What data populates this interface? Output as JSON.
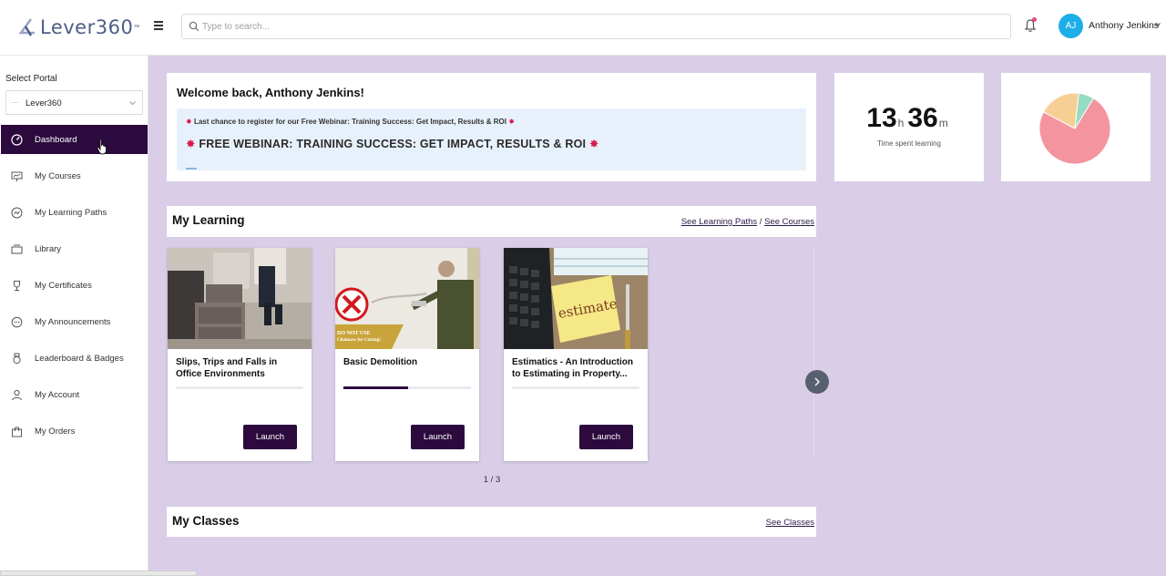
{
  "header": {
    "logo_text": "Lever360",
    "logo_tm": "™",
    "search_placeholder": "Type to search...",
    "user_initials": "AJ",
    "user_name": "Anthony Jenkins"
  },
  "sidebar": {
    "select_label": "Select Portal",
    "portal_value": "Lever360",
    "items": [
      {
        "label": "Dashboard",
        "icon": "dashboard-gauge-icon",
        "active": true
      },
      {
        "label": "My Courses",
        "icon": "presentation-icon"
      },
      {
        "label": "My Learning Paths",
        "icon": "path-icon"
      },
      {
        "label": "Library",
        "icon": "library-icon"
      },
      {
        "label": "My Certificates",
        "icon": "trophy-icon"
      },
      {
        "label": "My Announcements",
        "icon": "chat-icon"
      },
      {
        "label": "Leaderboard & Badges",
        "icon": "badge-icon"
      },
      {
        "label": "My Account",
        "icon": "user-icon"
      },
      {
        "label": "My Orders",
        "icon": "shopping-bag-icon"
      }
    ]
  },
  "welcome": {
    "title": "Welcome back, Anthony Jenkins!",
    "banner_small": "Last chance to register for our Free Webinar: Training Success: Get Impact, Results & ROI",
    "banner_big": "FREE WEBINAR: TRAINING SUCCESS: GET IMPACT, RESULTS & ROI"
  },
  "time_spent": {
    "hours": "13",
    "hours_unit": "h",
    "minutes": "36",
    "minutes_unit": "m",
    "label": "Time spent learning"
  },
  "pie": {
    "colors": [
      "#f4949f",
      "#f7cf94",
      "#97dcc1"
    ],
    "fractions": [
      0.74,
      0.19,
      0.07
    ]
  },
  "my_learning": {
    "title": "My Learning",
    "link_paths": "See Learning Paths",
    "separator": "/",
    "link_courses": "See Courses",
    "courses": [
      {
        "title": "Slips, Trips and Falls in Office Environments",
        "progress": 0,
        "launch": "Launch"
      },
      {
        "title": "Basic Demolition",
        "progress": 0.51,
        "launch": "Launch",
        "sign_text": "DO NOT USE",
        "sign_sub": "Chainsaw for Cutting!"
      },
      {
        "title": "Estimatics - An Introduction to Estimating in Property...",
        "progress": 0,
        "launch": "Launch",
        "note_text": "estimate"
      }
    ],
    "pager": "1 / 3"
  },
  "my_classes": {
    "title": "My Classes",
    "link": "See Classes"
  }
}
